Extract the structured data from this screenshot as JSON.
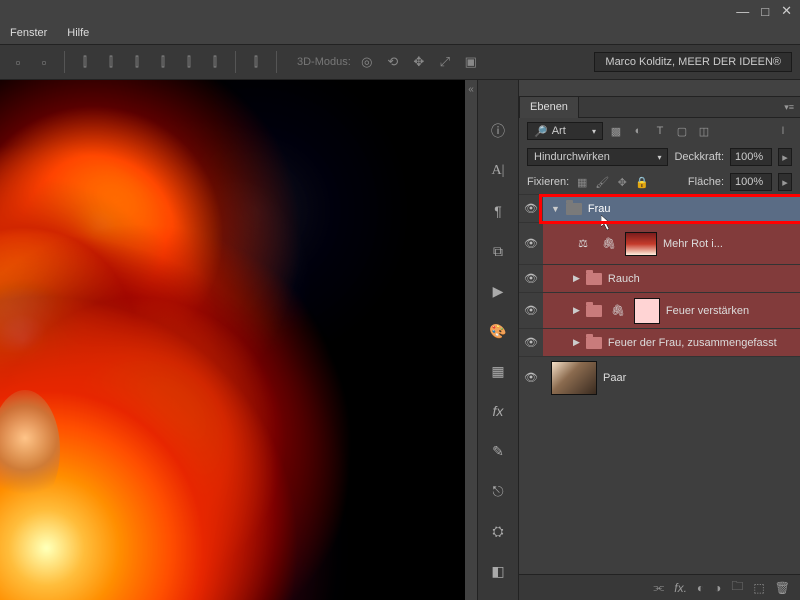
{
  "menubar": {
    "item1": "Fenster",
    "item2": "Hilfe"
  },
  "toolbar": {
    "mode3d_label": "3D-Modus:",
    "credit": "Marco Kolditz, MEER DER IDEEN®"
  },
  "panel": {
    "tab_label": "Ebenen",
    "kind_select": "Art",
    "blend_mode": "Hindurchwirken",
    "opacity_label": "Deckkraft:",
    "opacity_value": "100%",
    "lock_label": "Fixieren:",
    "fill_label": "Fläche:",
    "fill_value": "100%"
  },
  "layers": {
    "group_frau": "Frau",
    "child1": "Mehr Rot i...",
    "child2": "Rauch",
    "child3": "Feuer verstärken",
    "child4": "Feuer der Frau, zusammengefasst",
    "paar": "Paar"
  }
}
